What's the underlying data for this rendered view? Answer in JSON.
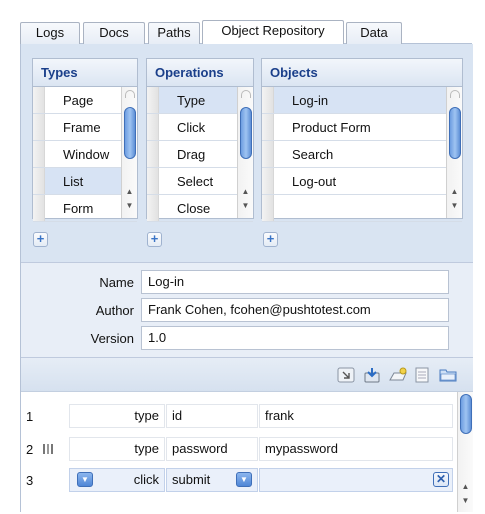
{
  "tabs": [
    "Logs",
    "Docs",
    "Paths",
    "Object Repository",
    "Data"
  ],
  "active_tab": "Object Repository",
  "types": {
    "header": "Types",
    "items": [
      "Page",
      "Frame",
      "Window",
      "List",
      "Form"
    ],
    "selected": "List"
  },
  "operations": {
    "header": "Operations",
    "items": [
      "Type",
      "Click",
      "Drag",
      "Select",
      "Close"
    ],
    "selected": "Type"
  },
  "objects": {
    "header": "Objects",
    "items": [
      "Log-in",
      "Product Form",
      "Search",
      "Log-out",
      ""
    ],
    "selected": "Log-in"
  },
  "add_glyph": "+",
  "properties": {
    "name_label": "Name",
    "name_value": "Log-in",
    "author_label": "Author",
    "author_value": "Frank Cohen, fcohen@pushtotest.com",
    "version_label": "Version",
    "version_value": "1.0"
  },
  "toolbar_icons": [
    "export-icon",
    "import-icon",
    "new-object-icon",
    "document-icon",
    "folder-icon"
  ],
  "steps": [
    {
      "num": "1",
      "command": "type",
      "target": "id",
      "value": "frank"
    },
    {
      "num": "2",
      "command": "type",
      "target": "password",
      "value": "mypassword"
    },
    {
      "num": "3",
      "command": "click",
      "target": "submit",
      "value": ""
    }
  ],
  "colors": {
    "accent": "#1a3f8a",
    "selection": "#d7e3f4",
    "scroll_thumb": "#6d9de0"
  }
}
